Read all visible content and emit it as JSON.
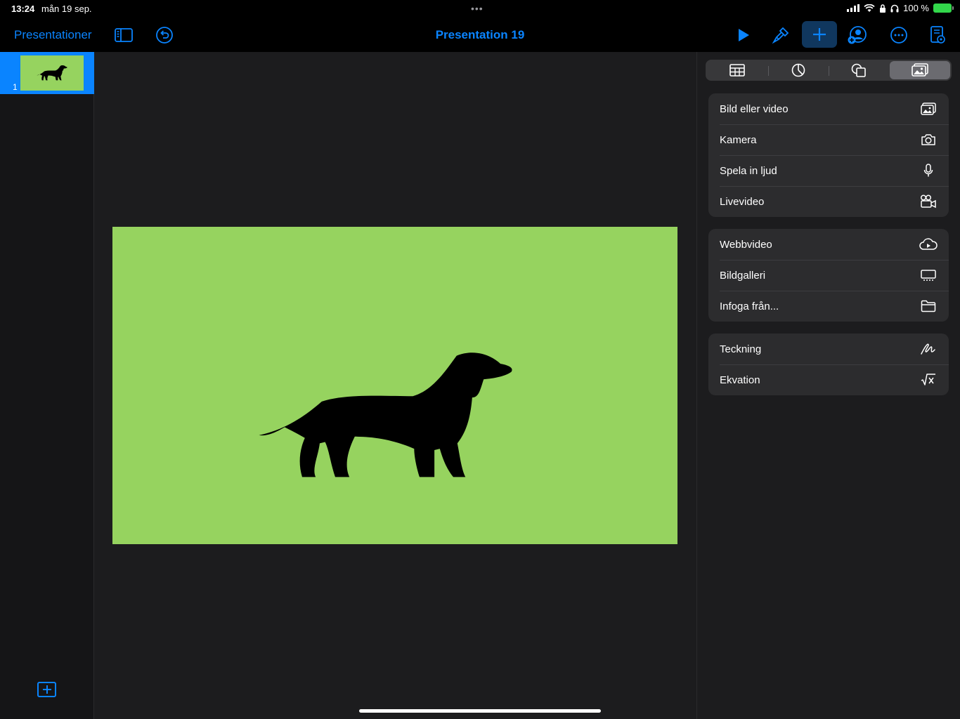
{
  "status_bar": {
    "time": "13:24",
    "date": "mån 19 sep.",
    "battery": "100 %"
  },
  "toolbar": {
    "back_label": "Presentationer",
    "document_title": "Presentation 19"
  },
  "navigator": {
    "slides": [
      {
        "number": "1"
      }
    ]
  },
  "insert_panel": {
    "tabs": [
      {
        "icon": "table-icon"
      },
      {
        "icon": "chart-icon"
      },
      {
        "icon": "shapes-icon"
      },
      {
        "icon": "media-icon",
        "selected": true
      }
    ],
    "groups": [
      [
        {
          "label": "Bild eller video",
          "icon": "photo-icon"
        },
        {
          "label": "Kamera",
          "icon": "camera-icon"
        },
        {
          "label": "Spela in ljud",
          "icon": "microphone-icon"
        },
        {
          "label": "Livevideo",
          "icon": "video-camera-icon"
        }
      ],
      [
        {
          "label": "Webbvideo",
          "icon": "cloud-play-icon"
        },
        {
          "label": "Bildgalleri",
          "icon": "gallery-icon"
        },
        {
          "label": "Infoga från...",
          "icon": "folder-icon"
        }
      ],
      [
        {
          "label": "Teckning",
          "icon": "drawing-icon"
        },
        {
          "label": "Ekvation",
          "icon": "equation-icon"
        }
      ]
    ]
  },
  "colors": {
    "accent": "#0a84ff",
    "slide_background": "#96d35f",
    "panel_row": "#2c2c2e"
  }
}
